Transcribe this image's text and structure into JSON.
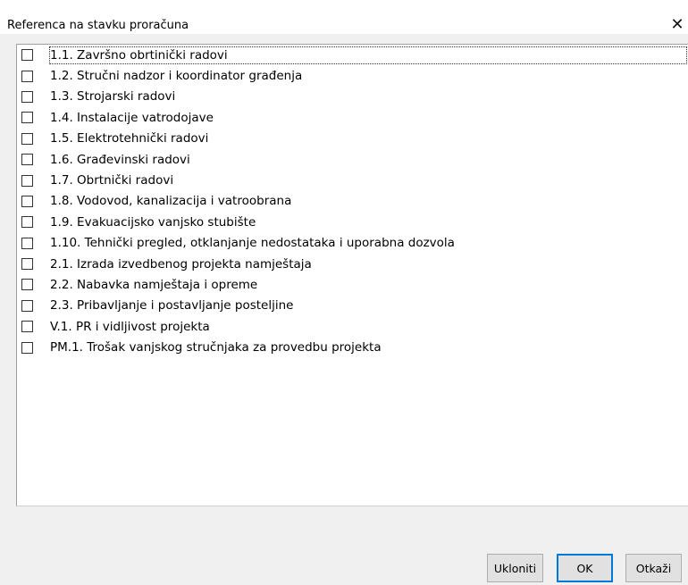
{
  "window": {
    "title": "Referenca na stavku proračuna",
    "close_glyph": "✕"
  },
  "list": {
    "items": [
      {
        "label": "1.1. Završno obrtinički radovi",
        "checked": false
      },
      {
        "label": "1.2. Stručni nadzor i koordinator građenja",
        "checked": false
      },
      {
        "label": "1.3. Strojarski radovi",
        "checked": false
      },
      {
        "label": "1.4. Instalacije vatrodojave",
        "checked": false
      },
      {
        "label": "1.5. Elektrotehnički radovi",
        "checked": false
      },
      {
        "label": "1.6. Građevinski radovi",
        "checked": false
      },
      {
        "label": "1.7. Obrtnički radovi",
        "checked": false
      },
      {
        "label": "1.8. Vodovod, kanalizacija i vatroobrana",
        "checked": false
      },
      {
        "label": "1.9. Evakuacijsko vanjsko stubište",
        "checked": false
      },
      {
        "label": "1.10. Tehnički pregled, otklanjanje nedostataka i uporabna dozvola",
        "checked": false
      },
      {
        "label": "2.1. Izrada izvedbenog projekta namještaja",
        "checked": false
      },
      {
        "label": "2.2. Nabavka namještaja i opreme",
        "checked": false
      },
      {
        "label": "2.3. Pribavljanje i postavljanje  posteljine",
        "checked": false
      },
      {
        "label": "V.1. PR i vidljivost projekta",
        "checked": false
      },
      {
        "label": "PM.1. Trošak vanjskog stručnjaka za provedbu projekta",
        "checked": false
      }
    ]
  },
  "buttons": {
    "remove_label": "Ukloniti",
    "ok_label": "OK",
    "cancel_label": "Otkaži"
  },
  "colors": {
    "focus_border": "#0078d7",
    "dialog_background": "#f0f0f0"
  },
  "icons": {
    "close": "close-icon",
    "checkbox": "checkbox-icon"
  }
}
